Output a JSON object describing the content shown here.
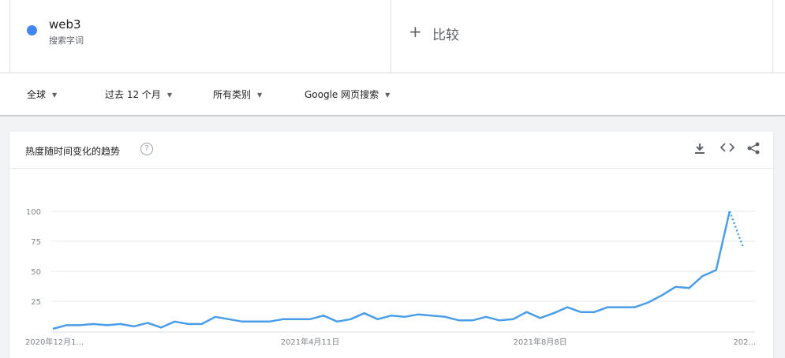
{
  "term": {
    "name": "web3",
    "subtitle": "搜索字词",
    "color": "#4285f4"
  },
  "compare": {
    "plus": "+",
    "label": "比较"
  },
  "filters": [
    {
      "label": "全球"
    },
    {
      "label": "过去 12 个月"
    },
    {
      "label": "所有类别"
    },
    {
      "label": "Google 网页搜索"
    }
  ],
  "card": {
    "title": "热度随时间变化的趋势",
    "help": "?"
  },
  "toolbar": {
    "download_icon": "download-icon",
    "embed_icon": "embed-code-icon",
    "share_icon": "share-icon"
  },
  "chart_data": {
    "type": "line",
    "color": "#4a9de8",
    "ylim": [
      0,
      100
    ],
    "yticks": [
      25,
      50,
      75,
      100
    ],
    "x_tick_labels": [
      {
        "label": "2020年12月1...",
        "index": 0
      },
      {
        "label": "2021年4月11日",
        "index": 19
      },
      {
        "label": "2021年8月8日",
        "index": 36
      },
      {
        "label": "202...",
        "index": 52
      }
    ],
    "series": [
      {
        "values": [
          2,
          5,
          5,
          6,
          5,
          6,
          4,
          7,
          3,
          8,
          6,
          6,
          12,
          10,
          8,
          8,
          8,
          10,
          10,
          10,
          13,
          8,
          10,
          15,
          10,
          13,
          12,
          14,
          13,
          12,
          9,
          9,
          12,
          9,
          10,
          16,
          11,
          15,
          20,
          16,
          16,
          20,
          20,
          20,
          24,
          30,
          37,
          36,
          46,
          51,
          100
        ],
        "partial_tail": 70
      }
    ]
  }
}
